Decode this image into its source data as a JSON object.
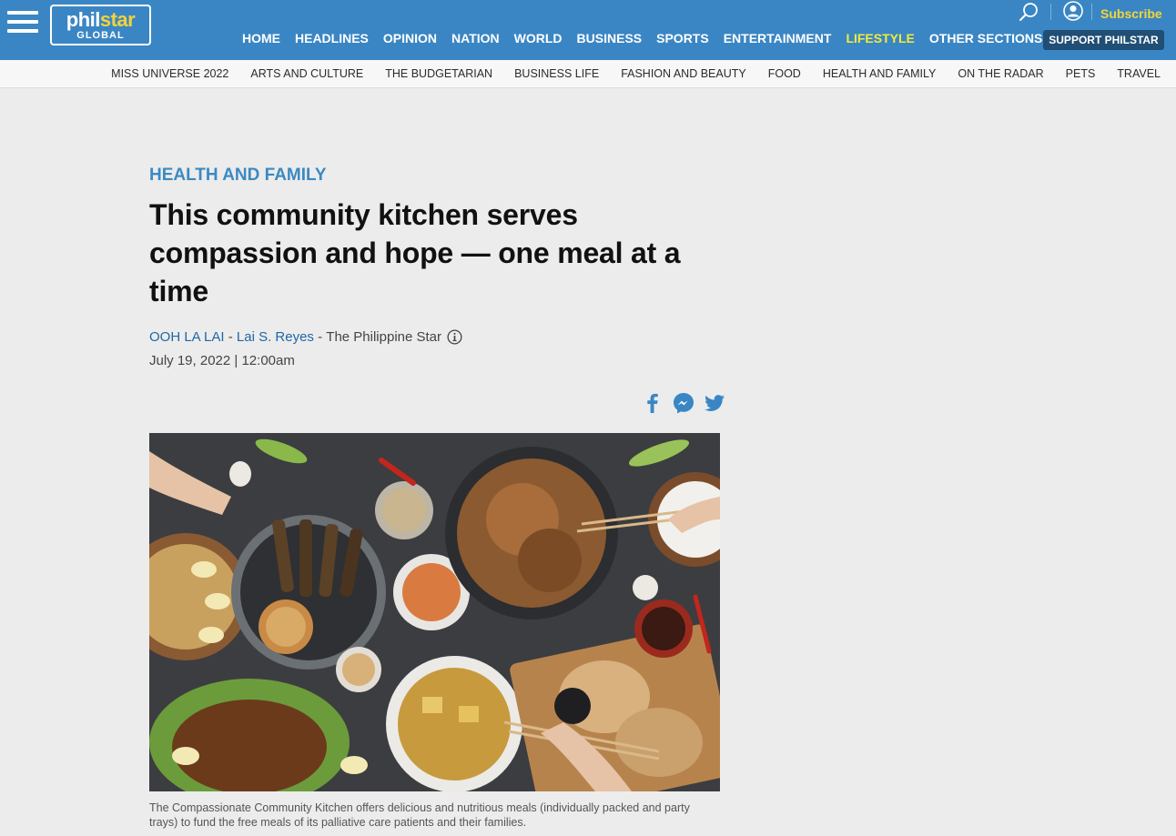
{
  "header": {
    "logo_main_a": "phil",
    "logo_main_b": "star",
    "logo_sub": "GLOBAL",
    "subscribe_label": "Subscribe",
    "support_label": "SUPPORT PHILSTAR",
    "accent_color": "#3a86c4",
    "active_color": "#f4ea3b",
    "nav": [
      {
        "label": "HOME"
      },
      {
        "label": "HEADLINES"
      },
      {
        "label": "OPINION"
      },
      {
        "label": "NATION"
      },
      {
        "label": "WORLD"
      },
      {
        "label": "BUSINESS"
      },
      {
        "label": "SPORTS"
      },
      {
        "label": "ENTERTAINMENT"
      },
      {
        "label": "LIFESTYLE",
        "active": true
      },
      {
        "label": "OTHER SECTIONS"
      }
    ],
    "icons": [
      "hamburger-icon",
      "search-icon",
      "user-icon"
    ]
  },
  "subnav": {
    "items": [
      "MISS UNIVERSE 2022",
      "ARTS AND CULTURE",
      "THE BUDGETARIAN",
      "BUSINESS LIFE",
      "FASHION AND BEAUTY",
      "FOOD",
      "HEALTH AND FAMILY",
      "ON THE RADAR",
      "PETS",
      "TRAVEL"
    ]
  },
  "article": {
    "section": "HEALTH AND FAMILY",
    "headline": "This community kitchen serves compassion and hope — one meal at a time",
    "column": "OOH LA LAI",
    "author": "Lai S. Reyes",
    "publication": "The Philippine Star",
    "byline_sep1": " - ",
    "byline_sep2": " - ",
    "date": "July 19, 2022 | 12:00am",
    "share_icons": [
      "facebook-icon",
      "messenger-icon",
      "twitter-icon"
    ],
    "caption": "The Compassionate Community Kitchen offers delicious and nutritious meals (individually packed and party trays) to fund the free meals of its palliative care patients and their families."
  }
}
